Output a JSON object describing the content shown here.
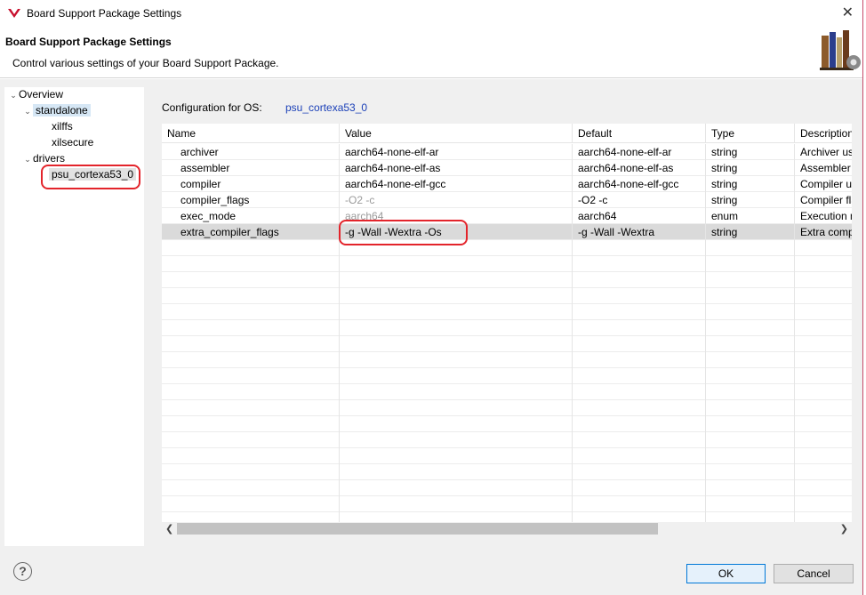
{
  "window": {
    "title": "Board Support Package Settings",
    "close_glyph": "✕"
  },
  "banner": {
    "heading": "Board Support Package Settings",
    "description": "Control various settings of your Board Support Package."
  },
  "tree": {
    "overview": "Overview",
    "standalone": "standalone",
    "xilffs": "xilffs",
    "xilsecure": "xilsecure",
    "drivers": "drivers",
    "processor": "psu_cortexa53_0"
  },
  "config": {
    "label": "Configuration for OS:",
    "value": "psu_cortexa53_0"
  },
  "table": {
    "headers": [
      "Name",
      "Value",
      "Default",
      "Type",
      "Description"
    ],
    "rows": [
      {
        "name": "archiver",
        "value": "aarch64-none-elf-ar",
        "default": "aarch64-none-elf-ar",
        "type": "string",
        "description": "Archiver used to archive libraries for both BSP generation as well as for applications"
      },
      {
        "name": "assembler",
        "value": "aarch64-none-elf-as",
        "default": "aarch64-none-elf-as",
        "type": "string",
        "description": "Assembler used to assemble both BSP/Libraries and applications"
      },
      {
        "name": "compiler",
        "value": "aarch64-none-elf-gcc",
        "default": "aarch64-none-elf-gcc",
        "type": "string",
        "description": "Compiler used to compile both BSP/Libraries and applications"
      },
      {
        "name": "compiler_flags",
        "value": "-O2 -c",
        "default": "-O2 -c",
        "type": "string",
        "description": "Compiler flags used in BSP and library generation"
      },
      {
        "name": "exec_mode",
        "value": "aarch64",
        "default": "aarch64",
        "type": "enum",
        "description": "Execution mode"
      },
      {
        "name": "extra_compiler_flags",
        "value": "-g -Wall -Wextra -Os",
        "default": "-g -Wall -Wextra",
        "type": "string",
        "description": "Extra compiler flags used in BSP and library generation"
      }
    ]
  },
  "footer": {
    "help_glyph": "?",
    "ok_label": "OK",
    "cancel_label": "Cancel"
  },
  "colors": {
    "accent": "#1c41b8",
    "annotation": "#e3242b",
    "selection": "#d6e7f5"
  }
}
